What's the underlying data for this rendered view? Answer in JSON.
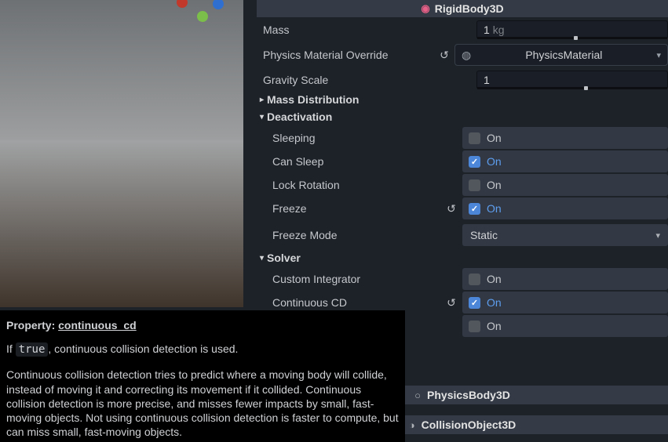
{
  "viewport": {
    "gizmo": [
      "red",
      "blue",
      "green"
    ]
  },
  "inspector": {
    "rigid": {
      "title": "RigidBody3D",
      "mass": {
        "label": "Mass",
        "value": "1",
        "unit": "kg",
        "thumb_pct": 51
      },
      "pmo": {
        "label": "Physics Material Override",
        "value": "PhysicsMaterial",
        "reset": true
      },
      "grav": {
        "label": "Gravity Scale",
        "value": "1",
        "thumb_pct": 56
      },
      "groups": {
        "mass_dist": {
          "label": "Mass Distribution",
          "open": false
        },
        "deact": {
          "label": "Deactivation",
          "open": true,
          "sleeping": {
            "label": "Sleeping",
            "checked": false,
            "text": "On",
            "reset": false
          },
          "can_sleep": {
            "label": "Can Sleep",
            "checked": true,
            "text": "On",
            "reset": false
          },
          "lock_rot": {
            "label": "Lock Rotation",
            "checked": false,
            "text": "On",
            "reset": false
          },
          "freeze": {
            "label": "Freeze",
            "checked": true,
            "text": "On",
            "reset": true
          },
          "freeze_mode": {
            "label": "Freeze Mode",
            "value": "Static"
          }
        },
        "solver": {
          "label": "Solver",
          "open": true,
          "custom_int": {
            "label": "Custom Integrator",
            "checked": false,
            "text": "On",
            "reset": false
          },
          "ccd": {
            "label": "Continuous CD",
            "checked": true,
            "text": "On",
            "reset": true
          },
          "extra": {
            "label": "",
            "checked": false,
            "text": "On",
            "reset": false
          }
        }
      }
    },
    "physbody": {
      "title": "PhysicsBody3D"
    },
    "collobj": {
      "title": "CollisionObject3D"
    }
  },
  "tooltip": {
    "prop_prefix": "Property:",
    "prop_name": "continuous_cd",
    "line_if": "If ",
    "code_true": "true",
    "line_rest": ", continuous collision detection is used.",
    "para2": "Continuous collision detection tries to predict where a moving body will collide, instead of moving it and correcting its movement if it collided. Continuous collision detection is more precise, and misses fewer impacts by small, fast-moving objects. Not using continuous collision detection is faster to compute, but can miss small, fast-moving objects."
  }
}
